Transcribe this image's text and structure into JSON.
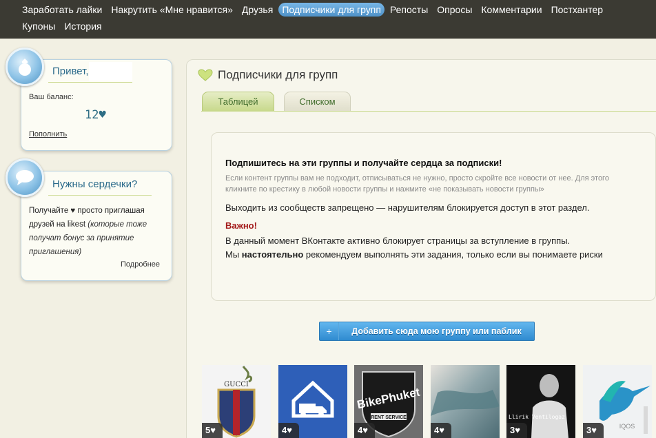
{
  "nav": {
    "row1": [
      {
        "label": "Заработать лайки",
        "active": false
      },
      {
        "label": "Накрутить «Мне нравится»",
        "active": false
      },
      {
        "label": "Друзья",
        "active": false
      },
      {
        "label": "Подписчики для групп",
        "active": true
      },
      {
        "label": "Репосты",
        "active": false
      },
      {
        "label": "Опросы",
        "active": false
      },
      {
        "label": "Комментарии",
        "active": false
      },
      {
        "label": "Постхантер",
        "active": false
      }
    ],
    "row2": [
      {
        "label": "Купоны",
        "active": false
      },
      {
        "label": "История",
        "active": false
      }
    ]
  },
  "greeting": {
    "title": "Привет,",
    "balance_label": "Ваш баланс:",
    "balance_value": "12♥",
    "topup_link": "Пополнить"
  },
  "promo": {
    "title": "Нужны сердечки?",
    "text_main": "Получайте ♥ просто приглашая друзей на likest ",
    "text_italic": "(которые тоже получат бонус за принятие приглашения)",
    "more_link": "Подробнее"
  },
  "main": {
    "title": "Подписчики для групп",
    "tabs": [
      {
        "label": "Таблицей",
        "active": true
      },
      {
        "label": "Списком",
        "active": false
      }
    ],
    "info": {
      "heading": "Подпишитесь на эти группы и получайте сердца за подписки!",
      "sub": "Если контент группы вам не подходит, отписываться не нужно, просто скройте все новости от нее. Для этого кликните по крестику в любой новости группы и нажмите «не показывать новости группы»",
      "rule": "Выходить из сообществ запрещено — нарушителям блокируется доступ в этот раздел.",
      "warn_label": "Важно!",
      "warn_line1": "В данный момент ВКонтакте активно блокирует страницы за вступление в группы.",
      "warn_line2_pre": "Мы ",
      "warn_line2_bold": "настоятельно",
      "warn_line2_post": " рекомендуем выполнять эти задания, только если вы понимаете риски"
    },
    "add_button": {
      "plus": "+",
      "label": "Добавить сюда мою группу или паблик"
    }
  },
  "groups": [
    {
      "icon": "gucci-crest-image",
      "reward": "5♥",
      "caption": "GUCCI"
    },
    {
      "icon": "delivery-truck-house-image",
      "reward": "4♥"
    },
    {
      "icon": "bikephuket-shield-image",
      "reward": "4♥",
      "caption": "BikePhuket",
      "subcaption": "RENT SERVICE"
    },
    {
      "icon": "blue-fabric-photo",
      "reward": "4♥"
    },
    {
      "icon": "rapper-portrait-photo",
      "reward": "3♥",
      "caption": "Llirik Ventilogaz"
    },
    {
      "icon": "hummingbird-iqos-image",
      "reward": "3♥",
      "caption": "IQOS"
    }
  ]
}
